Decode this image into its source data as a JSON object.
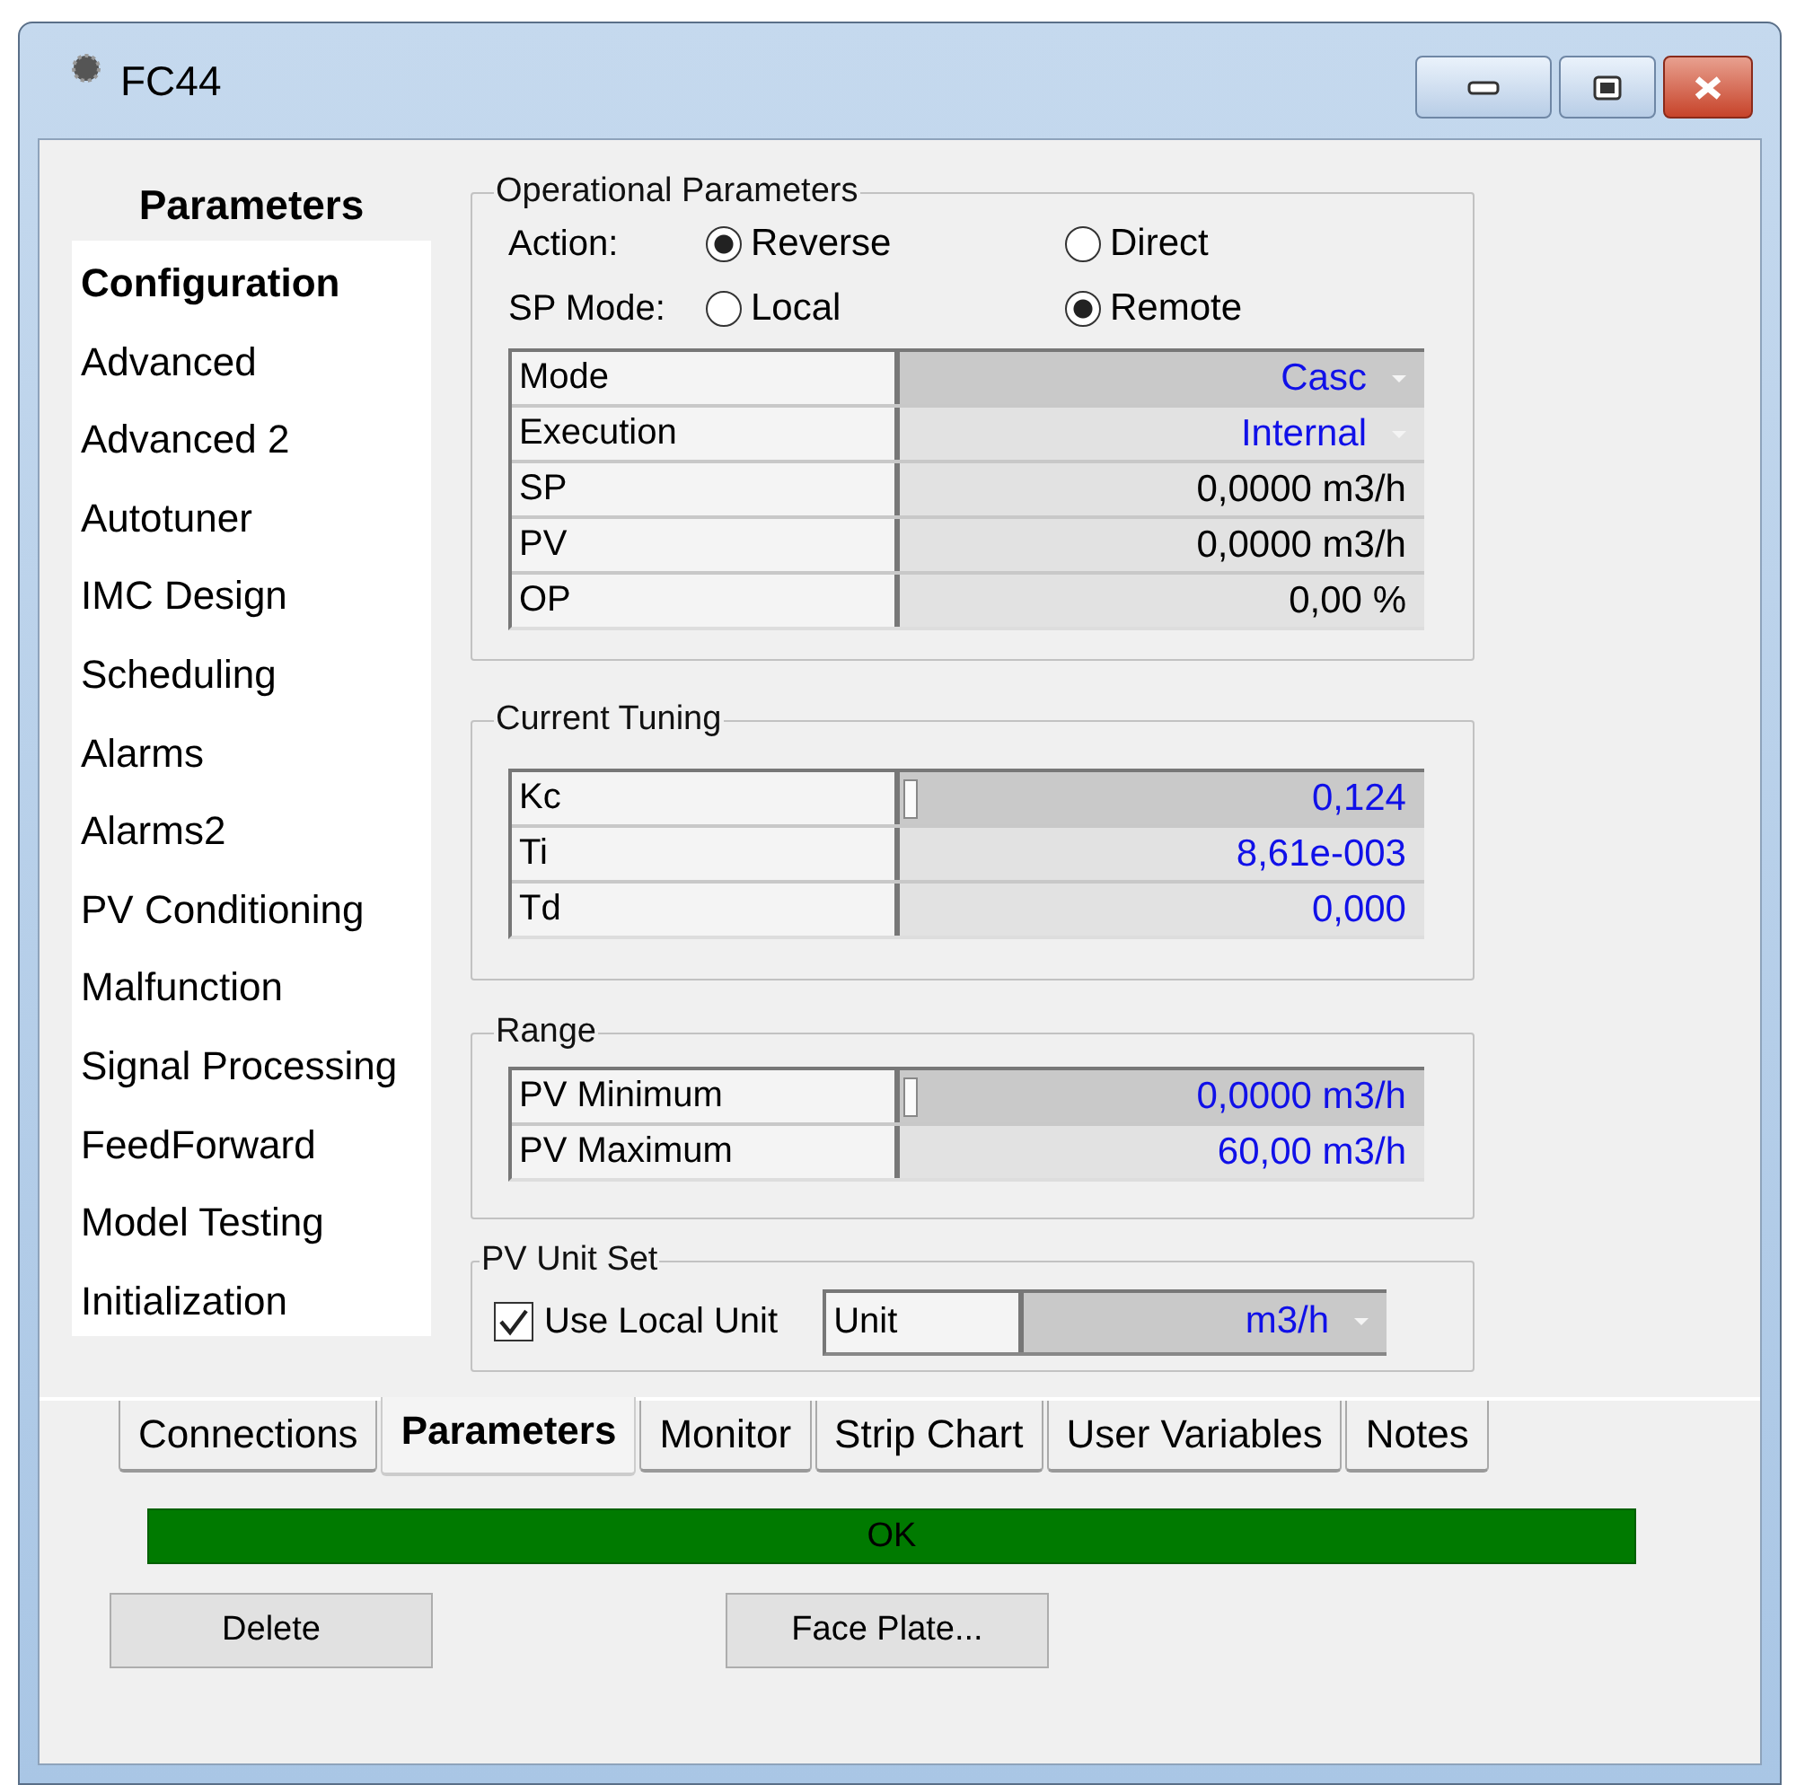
{
  "window": {
    "title": "FC44"
  },
  "sidebar": {
    "title": "Parameters",
    "items": [
      {
        "label": "Configuration",
        "selected": true
      },
      {
        "label": "Advanced",
        "selected": false
      },
      {
        "label": "Advanced 2",
        "selected": false
      },
      {
        "label": "Autotuner",
        "selected": false
      },
      {
        "label": "IMC Design",
        "selected": false
      },
      {
        "label": "Scheduling",
        "selected": false
      },
      {
        "label": "Alarms",
        "selected": false
      },
      {
        "label": "Alarms2",
        "selected": false
      },
      {
        "label": "PV Conditioning",
        "selected": false
      },
      {
        "label": "Malfunction",
        "selected": false
      },
      {
        "label": "Signal Processing",
        "selected": false
      },
      {
        "label": "FeedForward",
        "selected": false
      },
      {
        "label": "Model Testing",
        "selected": false
      },
      {
        "label": "Initialization",
        "selected": false
      }
    ]
  },
  "operational_parameters": {
    "title": "Operational Parameters",
    "radio_rows": [
      {
        "label": "Action:",
        "options": [
          {
            "label": "Reverse",
            "selected": true
          },
          {
            "label": "Direct",
            "selected": false
          }
        ]
      },
      {
        "label": "SP Mode:",
        "options": [
          {
            "label": "Local",
            "selected": false
          },
          {
            "label": "Remote",
            "selected": true
          }
        ]
      }
    ],
    "grid": [
      {
        "name": "Mode",
        "value": "Casc",
        "kind": "dropdown",
        "selected": true
      },
      {
        "name": "Execution",
        "value": "Internal",
        "kind": "dropdown",
        "selected": false
      },
      {
        "name": "SP",
        "value": "0,0000 m3/h",
        "kind": "readonly",
        "selected": false
      },
      {
        "name": "PV",
        "value": "0,0000 m3/h",
        "kind": "readonly",
        "selected": false
      },
      {
        "name": "OP",
        "value": "0,00 %",
        "kind": "readonly",
        "selected": false
      }
    ]
  },
  "current_tuning": {
    "title": "Current Tuning",
    "grid": [
      {
        "name": "Kc",
        "value": "0,124",
        "kind": "input",
        "selected": true
      },
      {
        "name": "Ti",
        "value": "8,61e-003",
        "kind": "input",
        "selected": false
      },
      {
        "name": "Td",
        "value": "0,000",
        "kind": "input",
        "selected": false
      }
    ]
  },
  "range": {
    "title": "Range",
    "grid": [
      {
        "name": "PV Minimum",
        "value": "0,0000 m3/h",
        "kind": "input",
        "selected": true
      },
      {
        "name": "PV Maximum",
        "value": "60,00 m3/h",
        "kind": "input",
        "selected": false
      }
    ]
  },
  "pv_unit_set": {
    "title": "PV Unit Set",
    "checkbox": {
      "label": "Use Local Unit",
      "checked": true
    },
    "unit": {
      "name": "Unit",
      "value": "m3/h",
      "kind": "dropdown",
      "selected": true
    }
  },
  "tabs": [
    {
      "label": "Connections",
      "selected": false
    },
    {
      "label": "Parameters",
      "selected": true
    },
    {
      "label": "Monitor",
      "selected": false
    },
    {
      "label": "Strip Chart",
      "selected": false
    },
    {
      "label": "User Variables",
      "selected": false
    },
    {
      "label": "Notes",
      "selected": false
    }
  ],
  "status": {
    "text": "OK",
    "color": "#007a00"
  },
  "buttons": [
    "Delete",
    "Face Plate..."
  ]
}
